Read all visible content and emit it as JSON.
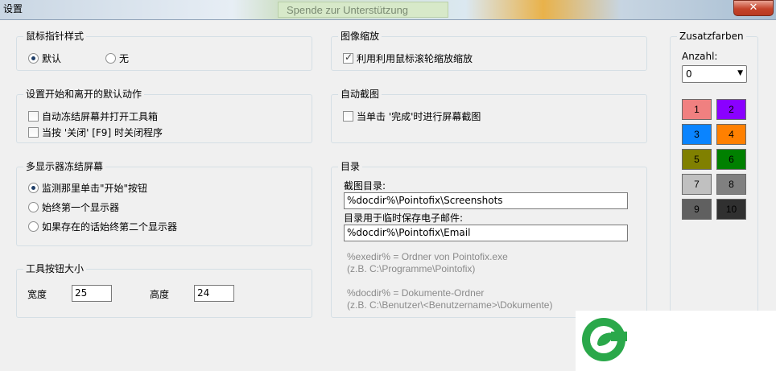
{
  "window": {
    "title": "设置",
    "close_label": "✕"
  },
  "background": {
    "badge_text": "Spende zur Unterstützung"
  },
  "pointer_style": {
    "legend": "鼠标指针样式",
    "options": [
      {
        "label": "默认",
        "checked": true
      },
      {
        "label": "无",
        "checked": false
      }
    ]
  },
  "image_zoom": {
    "legend": "图像缩放",
    "checkbox_label": "利用利用鼠标滚轮缩放缩放",
    "checked": true
  },
  "start_exit": {
    "legend": "设置开始和离开的默认动作",
    "options": [
      {
        "label": "自动冻结屏幕并打开工具箱",
        "checked": false
      },
      {
        "label": "当按 '关闭' [F9] 时关闭程序",
        "checked": false
      }
    ]
  },
  "auto_capture": {
    "legend": "自动截图",
    "checkbox_label": "当单击 '完成'时进行屏幕截图",
    "checked": false
  },
  "multi_monitor": {
    "legend": "多显示器冻结屏幕",
    "options": [
      {
        "label": "监测那里单击\"开始\"按钮",
        "checked": true
      },
      {
        "label": "始终第一个显示器",
        "checked": false
      },
      {
        "label": "如果存在的话始终第二个显示器",
        "checked": false
      }
    ]
  },
  "directory": {
    "legend": "目录",
    "screenshots_label": "截图目录:",
    "screenshots_value": "%docdir%\\Pointofix\\Screenshots",
    "email_label": "目录用于临时保存电子邮件:",
    "email_value": "%docdir%\\Pointofix\\Email",
    "note1_line1": "%exedir% = Ordner von Pointofix.exe",
    "note1_line2": "(z.B. C:\\Programme\\Pointofix)",
    "note2_line1": "%docdir% = Dokumente-Ordner",
    "note2_line2": "(z.B. C:\\Benutzer\\<Benutzername>\\Dokumente)"
  },
  "toolbar_size": {
    "legend": "工具按钮大小",
    "width_label": "宽度",
    "width_value": "25",
    "height_label": "高度",
    "height_value": "24"
  },
  "extra_colors": {
    "legend": "Zusatzfarben",
    "count_label": "Anzahl:",
    "count_value": "0",
    "swatches": [
      {
        "label": "1",
        "color": "#f08080",
        "text_color": "#000000"
      },
      {
        "label": "2",
        "color": "#8a00ff",
        "text_color": "#000000"
      },
      {
        "label": "3",
        "color": "#0a84ff",
        "text_color": "#000000"
      },
      {
        "label": "4",
        "color": "#ff8000",
        "text_color": "#000000"
      },
      {
        "label": "5",
        "color": "#808000",
        "text_color": "#000000"
      },
      {
        "label": "6",
        "color": "#008000",
        "text_color": "#000000"
      },
      {
        "label": "7",
        "color": "#c0c0c0",
        "text_color": "#000000"
      },
      {
        "label": "8",
        "color": "#808080",
        "text_color": "#000000"
      },
      {
        "label": "9",
        "color": "#606060",
        "text_color": "#000000"
      },
      {
        "label": "10",
        "color": "#303030",
        "text_color": "#000000"
      }
    ]
  },
  "icons": {
    "logo": "leaf-logo-icon",
    "dropdown": "chevron-down-icon"
  },
  "colors": {
    "logo_green": "#2aa84a",
    "panel_bg": "#f0f0f0",
    "group_border": "#d5dfe5"
  }
}
